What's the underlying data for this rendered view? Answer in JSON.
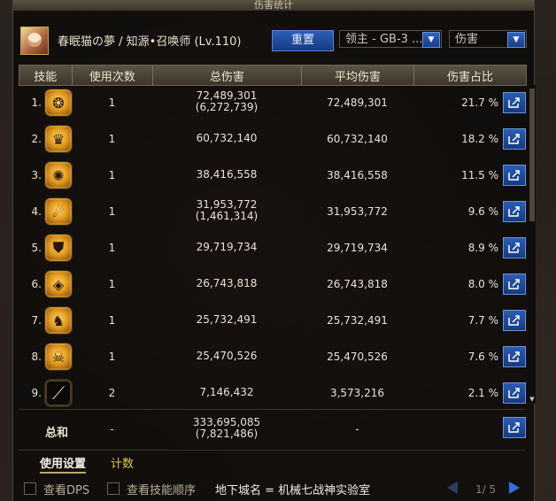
{
  "window": {
    "title": "伤害统计"
  },
  "header": {
    "character": "春眠猫の夢 / 知源•召唤师 (Lv.110)",
    "reset_label": "重置",
    "target_select": "领主 - GB-3 ...",
    "mode_select": "伤害"
  },
  "columns": [
    "技能",
    "使用次数",
    "总伤害",
    "平均伤害",
    "伤害占比"
  ],
  "rows": [
    {
      "idx": "1.",
      "uses": "1",
      "total": "72,489,301",
      "sub": "(6,272,739)",
      "avg": "72,489,301",
      "pct": "21.7 %"
    },
    {
      "idx": "2.",
      "uses": "1",
      "total": "60,732,140",
      "sub": "",
      "avg": "60,732,140",
      "pct": "18.2 %"
    },
    {
      "idx": "3.",
      "uses": "1",
      "total": "38,416,558",
      "sub": "",
      "avg": "38,416,558",
      "pct": "11.5 %"
    },
    {
      "idx": "4.",
      "uses": "1",
      "total": "31,953,772",
      "sub": "(1,461,314)",
      "avg": "31,953,772",
      "pct": "9.6 %"
    },
    {
      "idx": "5.",
      "uses": "1",
      "total": "29,719,734",
      "sub": "",
      "avg": "29,719,734",
      "pct": "8.9 %"
    },
    {
      "idx": "6.",
      "uses": "1",
      "total": "26,743,818",
      "sub": "",
      "avg": "26,743,818",
      "pct": "8.0 %"
    },
    {
      "idx": "7.",
      "uses": "1",
      "total": "25,732,491",
      "sub": "",
      "avg": "25,732,491",
      "pct": "7.7 %"
    },
    {
      "idx": "8.",
      "uses": "1",
      "total": "25,470,526",
      "sub": "",
      "avg": "25,470,526",
      "pct": "7.6 %"
    },
    {
      "idx": "9.",
      "uses": "2",
      "total": "7,146,432",
      "sub": "",
      "avg": "3,573,216",
      "pct": "2.1 %"
    }
  ],
  "summary": {
    "label": "总和",
    "uses": "-",
    "total": "333,695,085",
    "sub": "(7,821,486)",
    "avg": "-"
  },
  "tabs": {
    "settings": "使用设置",
    "count": "计数"
  },
  "footer": {
    "show_dps": "查看DPS",
    "show_order": "查看技能顺序",
    "dungeon": "地下城名 = 机械七战神实验室",
    "page": "1/ 5"
  }
}
